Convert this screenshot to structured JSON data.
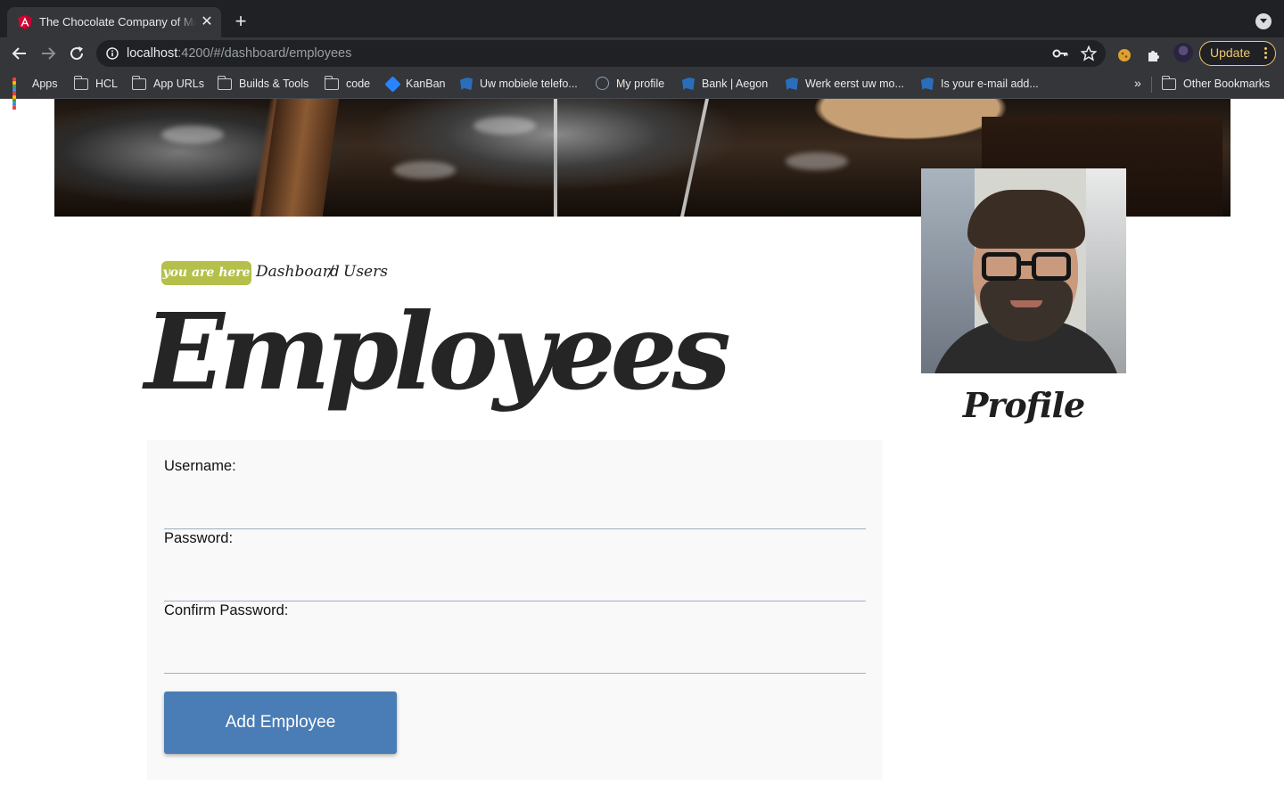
{
  "browser": {
    "tab_title": "The Chocolate Company of Ma",
    "new_tab_label": "+",
    "close_label": "✕",
    "url_host": "localhost",
    "url_rest": ":4200/#/dashboard/employees",
    "update_label": "Update",
    "bookmarks": [
      {
        "label": "Apps",
        "icon": "apps-grid-icon"
      },
      {
        "label": "HCL",
        "icon": "folder-icon"
      },
      {
        "label": "App URLs",
        "icon": "folder-icon"
      },
      {
        "label": "Builds & Tools",
        "icon": "folder-icon"
      },
      {
        "label": "code",
        "icon": "folder-icon"
      },
      {
        "label": "KanBan",
        "icon": "kanban-icon"
      },
      {
        "label": "Uw mobiele telefo...",
        "icon": "bookmark-site-icon"
      },
      {
        "label": "My profile",
        "icon": "profile-site-icon"
      },
      {
        "label": "Bank | Aegon",
        "icon": "bookmark-site-icon"
      },
      {
        "label": "Werk eerst uw mo...",
        "icon": "bookmark-site-icon"
      },
      {
        "label": "Is your e-mail add...",
        "icon": "bookmark-site-icon"
      }
    ],
    "overflow_label": "»",
    "other_bookmarks_label": "Other Bookmarks"
  },
  "breadcrumb": {
    "badge": "you are here",
    "items": [
      "Dashboard",
      "Users"
    ],
    "separator": "/"
  },
  "page": {
    "title": "Employees",
    "profile_label": "Profile"
  },
  "form": {
    "username_label": "Username:",
    "username_value": "",
    "password_label": "Password:",
    "password_value": "",
    "confirm_label": "Confirm Password:",
    "confirm_value": "",
    "submit_label": "Add Employee"
  },
  "colors": {
    "badge": "#b5c04a",
    "button": "#4a7db5",
    "panel": "#f9f9f9",
    "update_accent": "#f1c670"
  }
}
